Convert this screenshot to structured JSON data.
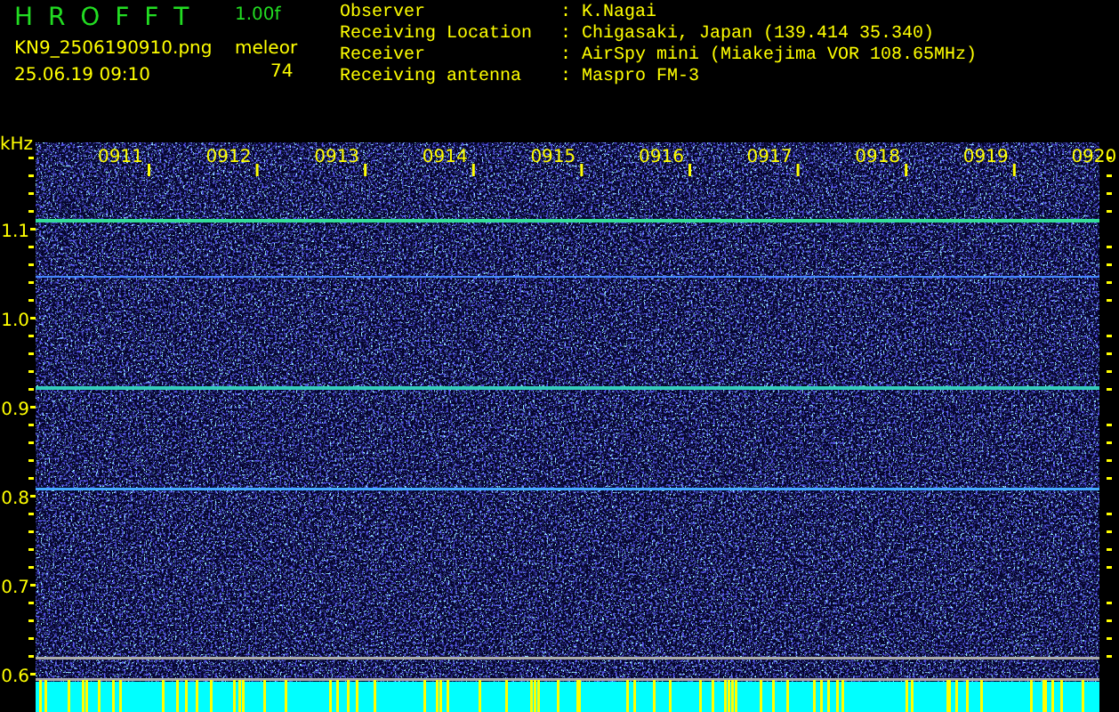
{
  "header": {
    "title": "H R O F F T",
    "version": "1.00f",
    "filename": "KN9_2506190910.png",
    "datetime": "25.06.19 09:10",
    "meteor_label": "meleor",
    "meteor_count": "74"
  },
  "info": [
    {
      "label": "Observer",
      "separator": ":",
      "value": "K.Nagai"
    },
    {
      "label": "Receiving Location",
      "separator": ":",
      "value": "Chigasaki, Japan (139.414 35.340)"
    },
    {
      "label": "Receiver",
      "separator": ":",
      "value": "AirSpy mini (Miakejima VOR 108.65MHz)"
    },
    {
      "label": "Receiving antenna",
      "separator": ":",
      "value": "Maspro FM-3"
    }
  ],
  "spectrogram": {
    "unit": "kHz",
    "time_ticks": [
      "0911",
      "0912",
      "0913",
      "0914",
      "0915",
      "0916",
      "0917",
      "0918",
      "0919",
      "0920"
    ],
    "freq_ticks": [
      "1.1",
      "1.0",
      "0.9",
      "0.8",
      "0.7",
      "0.6"
    ]
  }
}
